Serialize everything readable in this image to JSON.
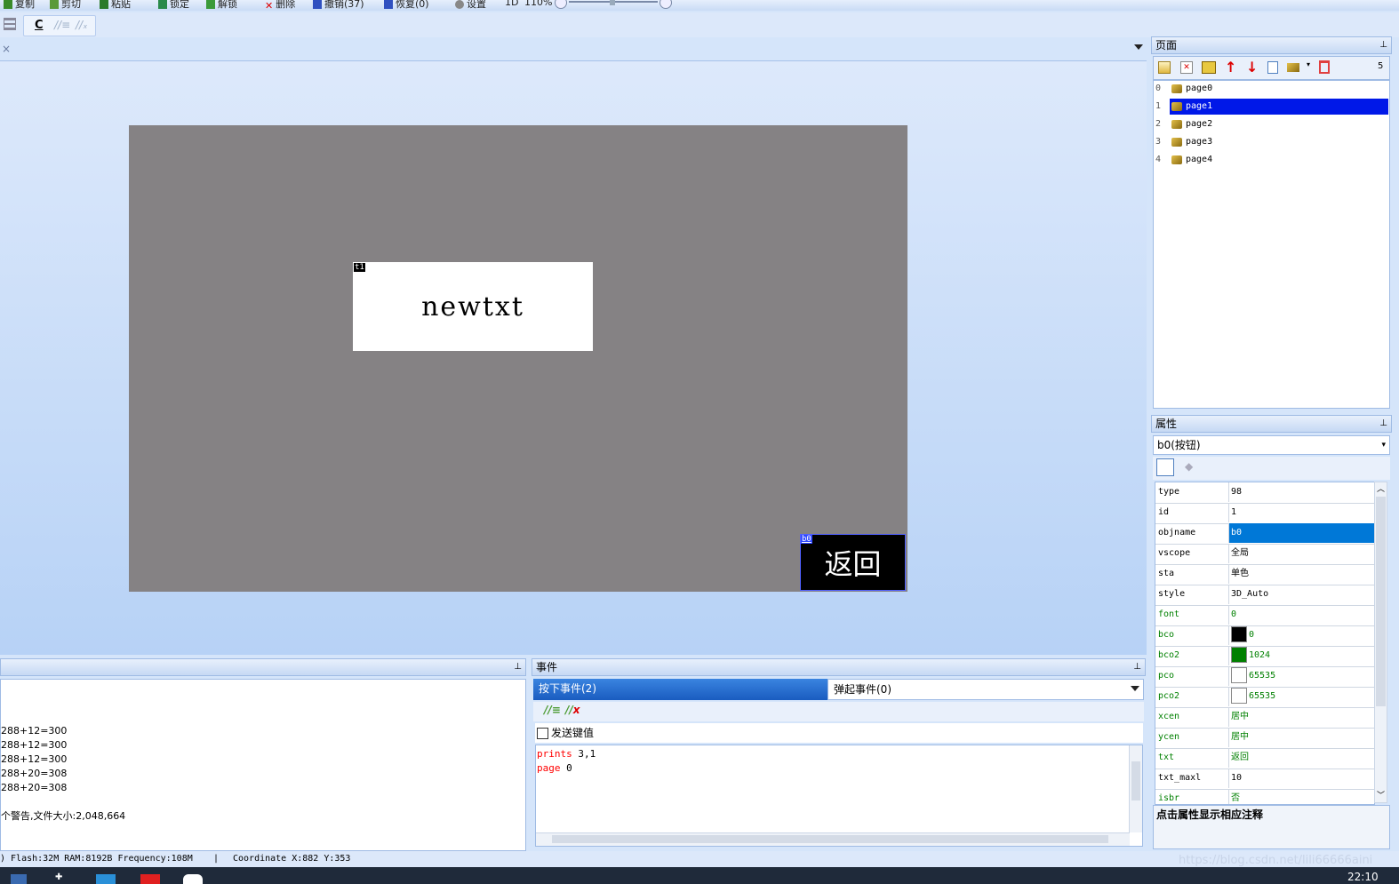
{
  "toolbar": {
    "items": [
      "复制",
      "剪切",
      "粘贴",
      "锁定",
      "解锁",
      "删除",
      "撤销(37)",
      "恢复(0)",
      "设置",
      "1D",
      "110%"
    ],
    "icon_labels": [
      "align-icon",
      "c-icon",
      "comment-icon",
      "uncomment-icon"
    ],
    "c_label": "C"
  },
  "editor": {
    "close_label": "×",
    "text_comp": {
      "tag": "t1",
      "text": "newtxt"
    },
    "button_comp": {
      "tag": "b0",
      "text": "返回"
    }
  },
  "pages_panel": {
    "title": "页面",
    "count": "5",
    "pages": [
      {
        "idx": "0",
        "name": "page0"
      },
      {
        "idx": "1",
        "name": "page1"
      },
      {
        "idx": "2",
        "name": "page2"
      },
      {
        "idx": "3",
        "name": "page3"
      },
      {
        "idx": "4",
        "name": "page4"
      }
    ],
    "selected_index": 1
  },
  "props_panel": {
    "title": "属性",
    "selector": "b0(按钮)",
    "rows": [
      {
        "k": "type",
        "v": "98"
      },
      {
        "k": "id",
        "v": "1"
      },
      {
        "k": "objname",
        "v": "b0"
      },
      {
        "k": "vscope",
        "v": "全局"
      },
      {
        "k": "sta",
        "v": "单色"
      },
      {
        "k": "style",
        "v": "3D_Auto"
      },
      {
        "k": "font",
        "v": "0"
      },
      {
        "k": "bco",
        "v": "0"
      },
      {
        "k": "bco2",
        "v": "1024"
      },
      {
        "k": "pco",
        "v": "65535"
      },
      {
        "k": "pco2",
        "v": "65535"
      },
      {
        "k": "xcen",
        "v": "居中"
      },
      {
        "k": "ycen",
        "v": "居中"
      },
      {
        "k": "txt",
        "v": "返回"
      },
      {
        "k": "txt_maxl",
        "v": "10"
      },
      {
        "k": "isbr",
        "v": "否"
      }
    ],
    "selected_row": 2,
    "green_rows": [
      6,
      7,
      8,
      9,
      10,
      11,
      12,
      13,
      15
    ],
    "swatches": {
      "bco": "#000000",
      "bco2": "#008000",
      "pco": "#ffffff",
      "pco2": "#ffffff"
    },
    "hint": "点击属性显示相应注释"
  },
  "output_panel": {
    "lines": [
      "288+12=300",
      "288+12=300",
      "288+12=300",
      "288+20=308",
      "288+20=308",
      "",
      "个警告,文件大小:2,048,664"
    ]
  },
  "event_panel": {
    "title": "事件",
    "tab_press": "按下事件(2)",
    "tab_release": "弹起事件(0)",
    "send_key_label": "发送键值",
    "code": [
      {
        "kw": "prints",
        "rest": " 3,1"
      },
      {
        "kw": "page",
        "rest": " 0"
      }
    ]
  },
  "statusbar": {
    "text": ") Flash:32M RAM:8192B Frequency:108M",
    "sep": "|",
    "coord": "Coordinate X:882  Y:353"
  },
  "taskbar": {
    "time": "22:10",
    "watermark": "https://blog.csdn.net/lili66666aini"
  },
  "colors": {
    "selection": "#0018e8",
    "page_bg": "#858284",
    "green_text": "#008000",
    "red_kw": "#ff0000"
  }
}
